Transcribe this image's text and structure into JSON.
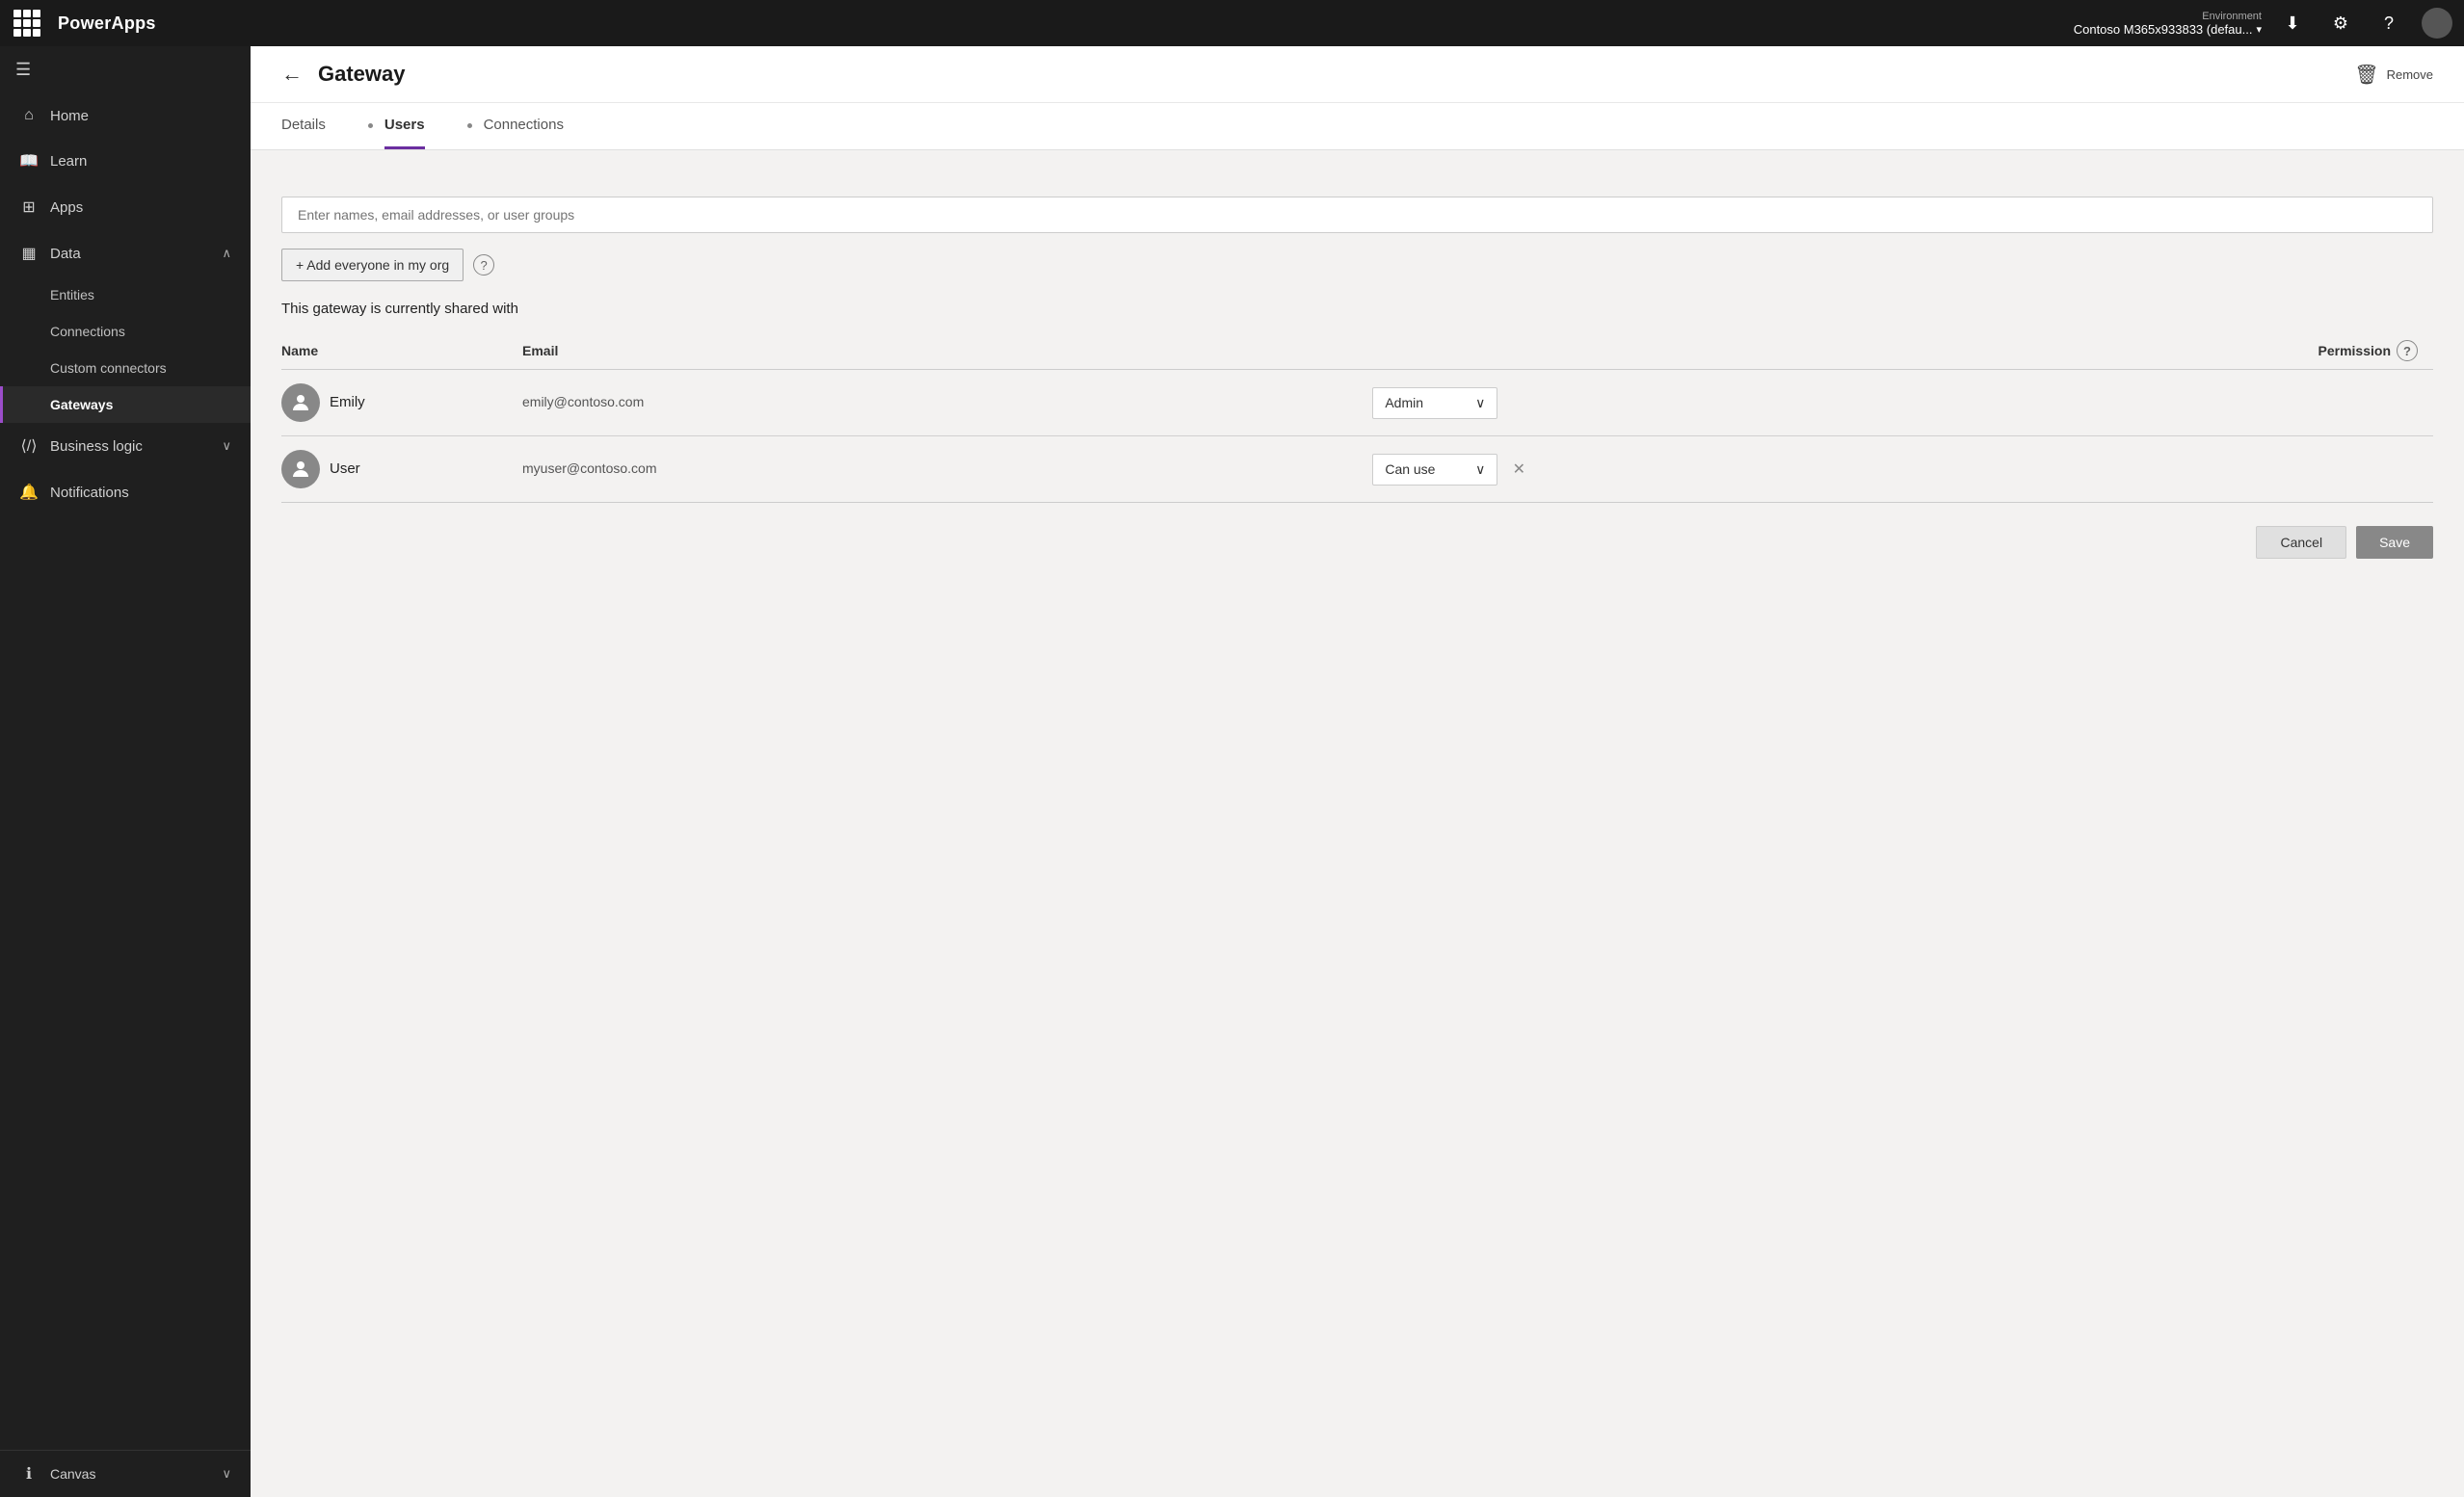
{
  "topbar": {
    "brand": "PowerApps",
    "env_label": "Environment",
    "env_name": "Contoso M365x933833 (defau...",
    "download_icon": "⬇",
    "settings_icon": "⚙",
    "help_icon": "?",
    "avatar_initial": ""
  },
  "sidebar": {
    "toggle_icon": "≡",
    "items": [
      {
        "id": "home",
        "label": "Home",
        "icon": "⌂"
      },
      {
        "id": "learn",
        "label": "Learn",
        "icon": "📖"
      },
      {
        "id": "apps",
        "label": "Apps",
        "icon": "⊞"
      },
      {
        "id": "data",
        "label": "Data",
        "icon": "▦",
        "has_chevron": true,
        "expanded": true
      },
      {
        "id": "entities",
        "label": "Entities",
        "sub": true
      },
      {
        "id": "connections",
        "label": "Connections",
        "sub": true
      },
      {
        "id": "custom_connectors",
        "label": "Custom connectors",
        "sub": true
      },
      {
        "id": "gateways",
        "label": "Gateways",
        "sub": true,
        "active": true
      },
      {
        "id": "business_logic",
        "label": "Business logic",
        "icon": "⟨⟩",
        "has_chevron": true
      },
      {
        "id": "notifications",
        "label": "Notifications",
        "icon": "🔔"
      }
    ],
    "bottom": {
      "label": "Canvas",
      "icon": "ℹ"
    }
  },
  "header": {
    "back_label": "←",
    "title": "Gateway",
    "remove_label": "Remove"
  },
  "tabs": [
    {
      "id": "details",
      "label": "Details",
      "active": false
    },
    {
      "id": "users",
      "label": "Users",
      "active": true
    },
    {
      "id": "connections",
      "label": "Connections",
      "active": false
    }
  ],
  "users_panel": {
    "search_placeholder": "Enter names, email addresses, or user groups",
    "add_org_label": "+ Add everyone in my org",
    "shared_with_text": "This gateway is currently shared with",
    "table_headers": {
      "name": "Name",
      "email": "Email",
      "permission": "Permission"
    },
    "users": [
      {
        "id": "emily",
        "name": "Emily",
        "email": "emily@contoso.com",
        "permission": "Admin",
        "can_delete": false
      },
      {
        "id": "user",
        "name": "User",
        "email": "myuser@contoso.com",
        "permission": "Can use",
        "can_delete": true
      }
    ],
    "cancel_label": "Cancel",
    "save_label": "Save"
  }
}
